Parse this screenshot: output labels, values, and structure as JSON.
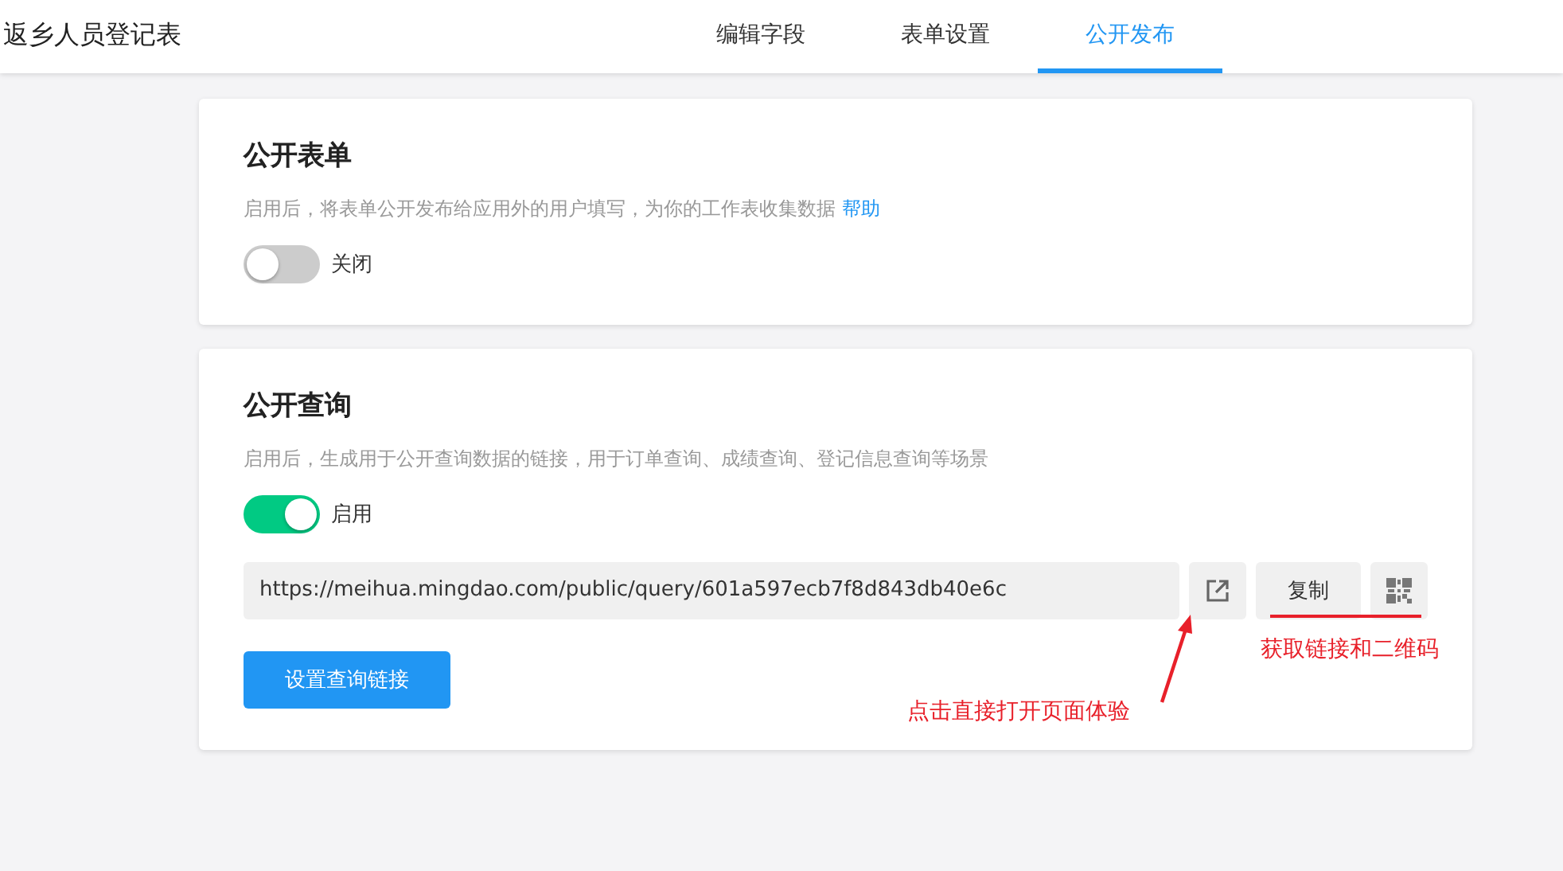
{
  "header": {
    "title": "返乡人员登记表",
    "tabs": [
      {
        "label": "编辑字段",
        "selected": false
      },
      {
        "label": "表单设置",
        "selected": false
      },
      {
        "label": "公开发布",
        "selected": true
      }
    ]
  },
  "sections": [
    {
      "title": "公开表单",
      "description": "启用后，将表单公开发布给应用外的用户填写，为你的工作表收集数据",
      "help_link": "帮助",
      "toggle": {
        "on": false,
        "label": "关闭"
      }
    },
    {
      "title": "公开查询",
      "description": "启用后，生成用于公开查询数据的链接，用于订单查询、成绩查询、登记信息查询等场景",
      "toggle": {
        "on": true,
        "label": "启用"
      },
      "link": "https://meihua.mingdao.com/public/query/601a597ecb7f8d843db40e6c",
      "copy_button": "复制",
      "settings_button": "设置查询链接"
    }
  ],
  "annotations": [
    {
      "text": "获取链接和二维码"
    },
    {
      "text": "点击直接打开页面体验"
    }
  ]
}
